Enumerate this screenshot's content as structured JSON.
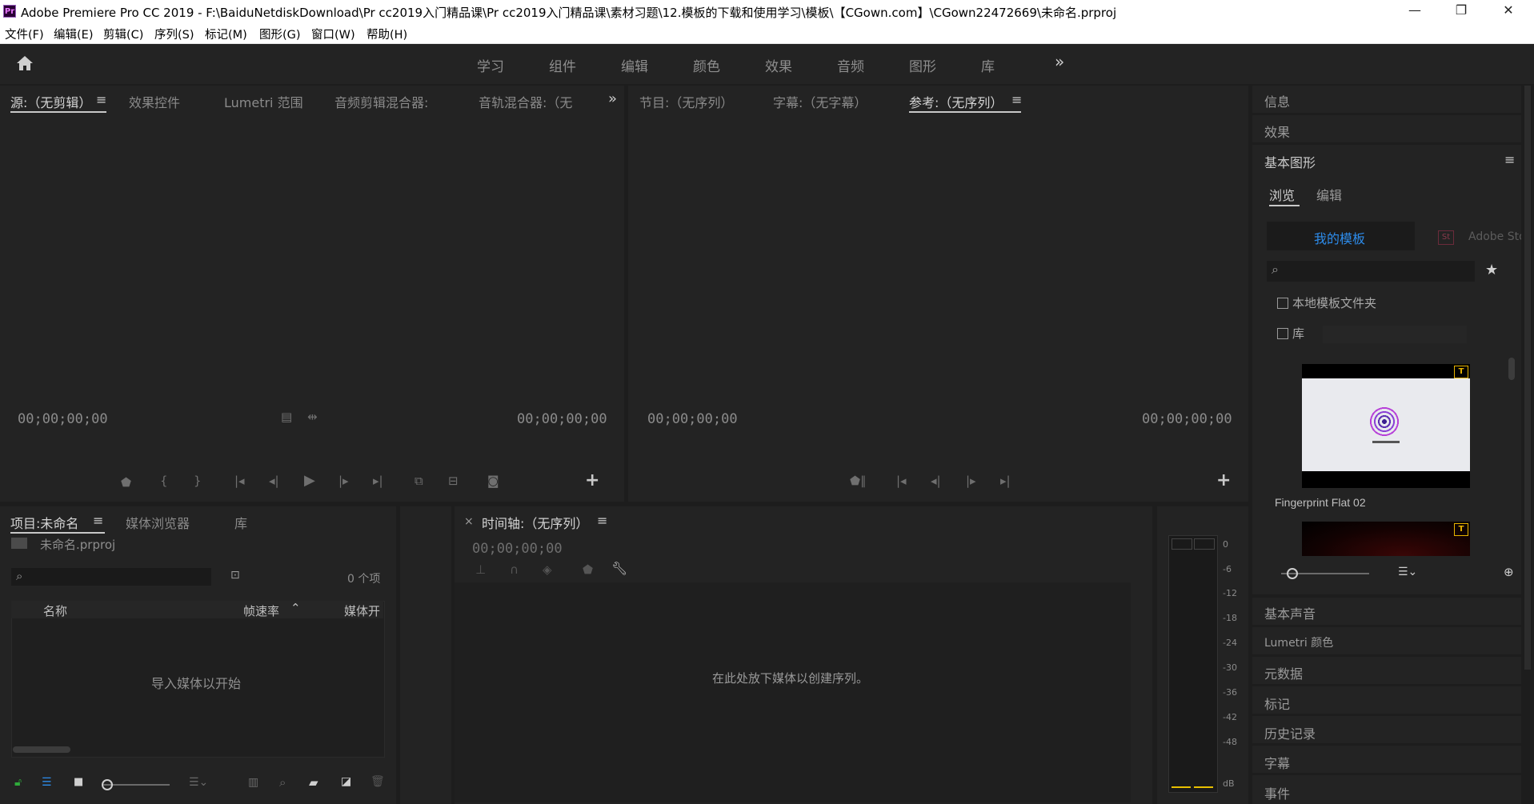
{
  "window": {
    "logo": "Pr",
    "title": "Adobe Premiere Pro CC 2019 - F:\\BaiduNetdiskDownload\\Pr cc2019入门精品课\\Pr cc2019入门精品课\\素材习题\\12.模板的下载和使用学习\\模板\\【CGown.com】\\CGown22472669\\未命名.prproj",
    "minimize": "—",
    "maximize": "❐",
    "close": "✕"
  },
  "menu": [
    "文件(F)",
    "编辑(E)",
    "剪辑(C)",
    "序列(S)",
    "标记(M)",
    "图形(G)",
    "窗口(W)",
    "帮助(H)"
  ],
  "workspaces": {
    "home_icon": "home-icon",
    "items": [
      "学习",
      "组件",
      "编辑",
      "颜色",
      "效果",
      "音频",
      "图形",
      "库"
    ],
    "more": "»"
  },
  "source_panel": {
    "tabs": [
      "源:（无剪辑）",
      "效果控件",
      "Lumetri 范围",
      "音频剪辑混合器:",
      "音轨混合器:（无"
    ],
    "menu_glyph": "≡",
    "more": "»",
    "timecode_left": "00;00;00;00",
    "timecode_right": "00;00;00;00",
    "plus": "+"
  },
  "program_panel": {
    "tabs": [
      "节目:（无序列）",
      "字幕:（无字幕）",
      "参考:（无序列）"
    ],
    "menu_glyph": "≡",
    "timecode_left": "00;00;00;00",
    "timecode_right": "00;00;00;00",
    "plus": "+"
  },
  "project_panel": {
    "tabs": [
      "项目:未命名",
      "媒体浏览器",
      "库"
    ],
    "menu_glyph": "≡",
    "file_name": "未命名.prproj",
    "item_count": "0 个项",
    "columns": [
      "名称",
      "帧速率",
      "媒体开"
    ],
    "empty_text": "导入媒体以开始"
  },
  "timeline_panel": {
    "close": "×",
    "title": "时间轴:（无序列）",
    "menu_glyph": "≡",
    "timecode": "00;00;00;00",
    "drop_text": "在此处放下媒体以创建序列。"
  },
  "audio_meter": {
    "scale": [
      "0",
      "-6",
      "-12",
      "-18",
      "-24",
      "-30",
      "-36",
      "-42",
      "-48",
      "dB"
    ]
  },
  "right_panel": {
    "top_headers": [
      "信息",
      "效果"
    ],
    "essential_graphics": {
      "title": "基本图形",
      "menu_glyph": "≡",
      "subtabs": [
        "浏览",
        "编辑"
      ],
      "template_tabs": [
        "我的模板",
        "Adobe Sto"
      ],
      "stock_badge": "St",
      "local_folder_label": "本地模板文件夹",
      "library_label": "库",
      "star": "★",
      "templates": [
        {
          "name": "Fingerprint Flat 02",
          "badge": "T"
        },
        {
          "name": "",
          "badge": "T"
        }
      ]
    },
    "bottom_headers": [
      "基本声音",
      "Lumetri 颜色",
      "元数据",
      "标记",
      "历史记录",
      "字幕",
      "事件"
    ]
  },
  "colors": {
    "accent_blue": "#2d8ceb",
    "badge_yellow": "#e8b400",
    "panel_bg": "#232323",
    "app_bg": "#1d1d1d"
  }
}
